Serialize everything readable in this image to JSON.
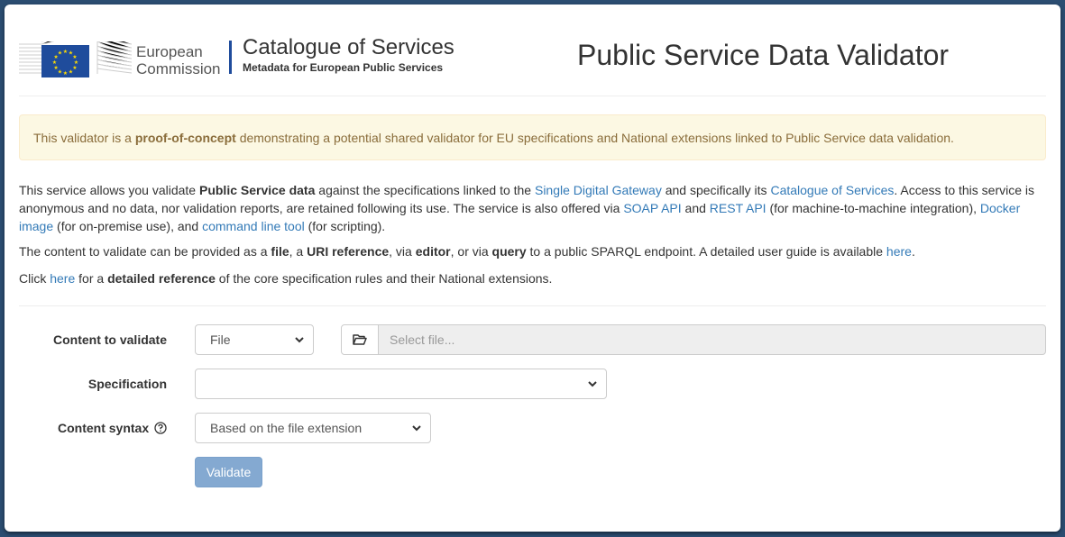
{
  "header": {
    "org_line1": "European",
    "org_line2": "Commission",
    "catalogue_title": "Catalogue of Services",
    "catalogue_subtitle": "Metadata for European Public Services",
    "app_title": "Public Service Data Validator",
    "flag_color": "#1f4c9c",
    "star_color": "#ffdd00"
  },
  "alert": [
    {
      "t": "text",
      "v": "This validator is a "
    },
    {
      "t": "bold",
      "v": "proof-of-concept"
    },
    {
      "t": "text",
      "v": " demonstrating a potential shared validator for EU specifications and National extensions linked to Public Service data validation."
    }
  ],
  "intro": [
    {
      "t": "text",
      "v": "This service allows you validate "
    },
    {
      "t": "bold",
      "v": "Public Service data"
    },
    {
      "t": "text",
      "v": " against the specifications linked to the "
    },
    {
      "t": "link",
      "v": "Single Digital Gateway"
    },
    {
      "t": "text",
      "v": " and specifically its "
    },
    {
      "t": "link",
      "v": "Catalogue of Services"
    },
    {
      "t": "text",
      "v": ". Access to this service is anonymous and no data, nor validation reports, are retained following its use. The service is also offered via "
    },
    {
      "t": "link",
      "v": "SOAP API"
    },
    {
      "t": "text",
      "v": " and "
    },
    {
      "t": "link",
      "v": "REST API"
    },
    {
      "t": "text",
      "v": " (for machine-to-machine integration), "
    },
    {
      "t": "link",
      "v": "Docker image"
    },
    {
      "t": "text",
      "v": " (for on-premise use), and "
    },
    {
      "t": "link",
      "v": "command line tool"
    },
    {
      "t": "text",
      "v": " (for scripting)."
    }
  ],
  "content_info": [
    {
      "t": "text",
      "v": "The content to validate can be provided as a "
    },
    {
      "t": "bold",
      "v": "file"
    },
    {
      "t": "text",
      "v": ", a "
    },
    {
      "t": "bold",
      "v": "URI reference"
    },
    {
      "t": "text",
      "v": ", via "
    },
    {
      "t": "bold",
      "v": "editor"
    },
    {
      "t": "text",
      "v": ", or via "
    },
    {
      "t": "bold",
      "v": "query"
    },
    {
      "t": "text",
      "v": " to a public SPARQL endpoint. A detailed user guide is available "
    },
    {
      "t": "link",
      "v": "here"
    },
    {
      "t": "text",
      "v": "."
    }
  ],
  "reference_info": [
    {
      "t": "text",
      "v": "Click "
    },
    {
      "t": "link",
      "v": "here"
    },
    {
      "t": "text",
      "v": " for a "
    },
    {
      "t": "bold",
      "v": "detailed reference"
    },
    {
      "t": "text",
      "v": " of the core specification rules and their National extensions."
    }
  ],
  "form": {
    "content_label": "Content to validate",
    "content_type_value": "File",
    "file_placeholder": "Select file...",
    "specification_label": "Specification",
    "specification_value": "",
    "syntax_label": "Content syntax",
    "syntax_value": "Based on the file extension",
    "validate_label": "Validate"
  }
}
